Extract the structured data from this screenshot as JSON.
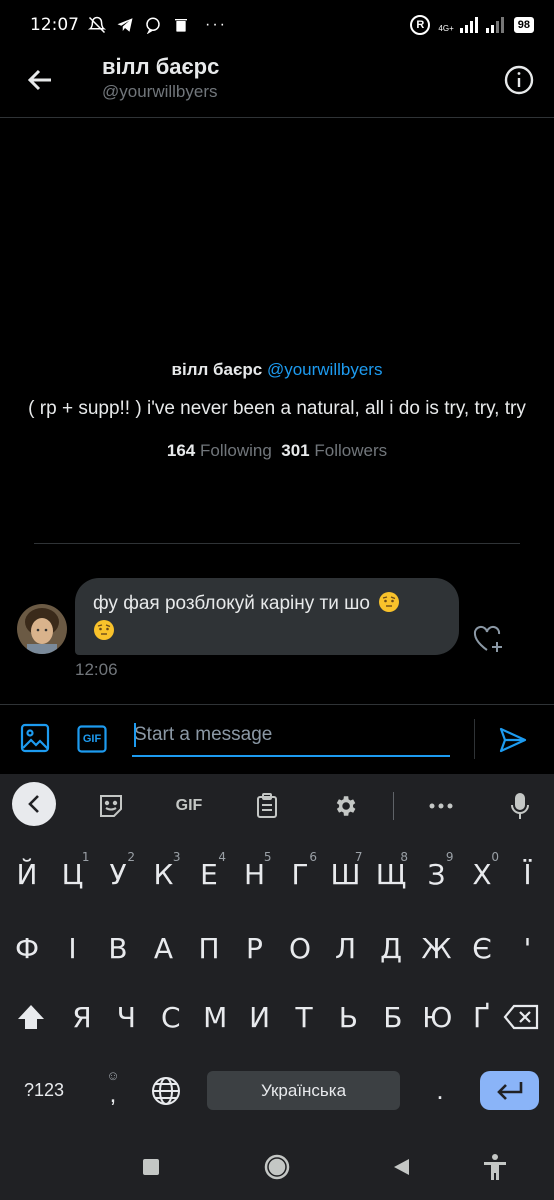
{
  "status_bar": {
    "time": "12:07",
    "network": "4G+",
    "battery": "98",
    "more": "···"
  },
  "header": {
    "name": "вілл баєрс",
    "handle": "@yourwillbyers"
  },
  "profile": {
    "name": "вілл баєрс",
    "handle": "@yourwillbyers",
    "bio": "( rp + supp!! ) i've never been a natural, all i do is try, try, try",
    "following_count": "164",
    "following_label": "Following",
    "followers_count": "301",
    "followers_label": "Followers"
  },
  "message": {
    "text_line1": "фу фая розблокуй каріну ти шо",
    "time": "12:06",
    "emoji": "face-with-raised-eyebrow"
  },
  "composer": {
    "placeholder": "Start a message",
    "gif_label": "GIF"
  },
  "keyboard": {
    "toolbar_gif": "GIF",
    "row1": [
      {
        "k": "Й",
        "h": ""
      },
      {
        "k": "Ц",
        "h": "1"
      },
      {
        "k": "У",
        "h": "2"
      },
      {
        "k": "К",
        "h": "3"
      },
      {
        "k": "Е",
        "h": "4"
      },
      {
        "k": "Н",
        "h": "5"
      },
      {
        "k": "Г",
        "h": "6"
      },
      {
        "k": "Ш",
        "h": "7"
      },
      {
        "k": "Щ",
        "h": "8"
      },
      {
        "k": "З",
        "h": "9"
      },
      {
        "k": "Х",
        "h": "0"
      },
      {
        "k": "Ї",
        "h": ""
      }
    ],
    "row2": [
      "Ф",
      "І",
      "В",
      "А",
      "П",
      "Р",
      "О",
      "Л",
      "Д",
      "Ж",
      "Є",
      "'"
    ],
    "row3": [
      "Я",
      "Ч",
      "С",
      "М",
      "И",
      "Т",
      "Ь",
      "Б",
      "Ю",
      "Ґ"
    ],
    "symbols_label": "?123",
    "comma": ",",
    "space_label": "Українська",
    "period": "."
  }
}
